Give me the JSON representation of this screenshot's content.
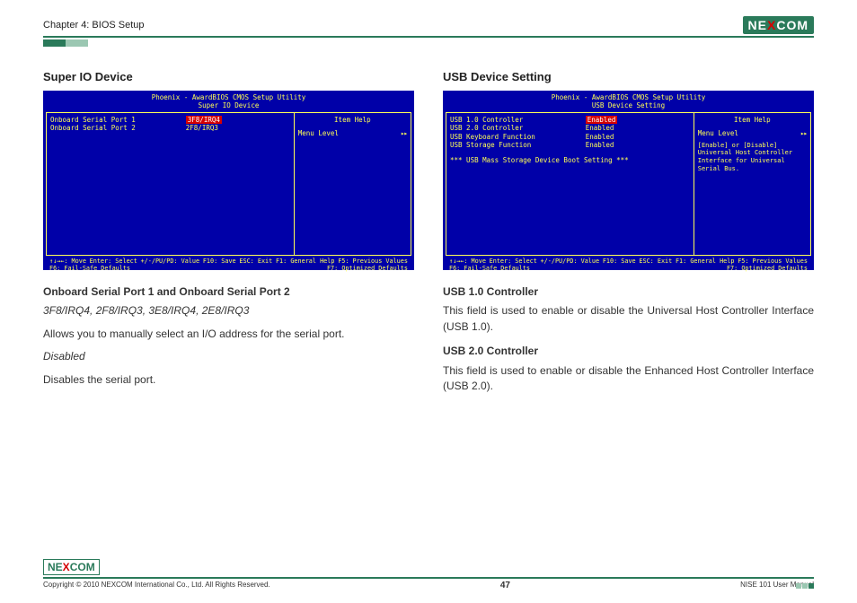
{
  "header": {
    "chapter": "Chapter 4: BIOS Setup",
    "logo_pre": "NE",
    "logo_x": "X",
    "logo_post": "COM"
  },
  "left": {
    "heading": "Super IO Device",
    "bios": {
      "title1": "Phoenix - AwardBIOS CMOS Setup Utility",
      "title2": "Super IO Device",
      "rows": [
        {
          "label": "Onboard Serial Port 1",
          "val": "3F8/IRQ4",
          "selected": true
        },
        {
          "label": "Onboard Serial Port 2",
          "val": "2F8/IRQ3",
          "selected": false
        }
      ],
      "item_help": "Item Help",
      "menu_level": "Menu Level",
      "menu_arrow": "▸▸",
      "help_text": "",
      "footer_keys": [
        "↑↓→←: Move",
        "Enter: Select",
        "+/-/PU/PD: Value",
        "F10: Save",
        "ESC: Exit",
        "F1: General Help",
        "F5: Previous Values",
        "F6: Fail-Safe Defaults",
        "F7: Optimized Defaults"
      ]
    },
    "body": {
      "sub": "Onboard Serial Port 1 and Onboard Serial Port 2",
      "italic1": "3F8/IRQ4, 2F8/IRQ3, 3E8/IRQ4, 2E8/IRQ3",
      "line1": "Allows you to manually select an I/O address for the serial port.",
      "italic2": "Disabled",
      "line2": "Disables the serial port."
    }
  },
  "right": {
    "heading": "USB Device Setting",
    "bios": {
      "title1": "Phoenix - AwardBIOS CMOS Setup Utility",
      "title2": "USB Device Setting",
      "rows": [
        {
          "label": "USB 1.0 Controller",
          "val": "Enabled",
          "selected": true
        },
        {
          "label": "USB 2.0 Controller",
          "val": "Enabled",
          "selected": false
        },
        {
          "label": "USB Keyboard Function",
          "val": "Enabled",
          "selected": false
        },
        {
          "label": "USB Storage Function",
          "val": "Enabled",
          "selected": false
        }
      ],
      "note": "*** USB Mass Storage Device Boot Setting ***",
      "item_help": "Item Help",
      "menu_level": "Menu Level",
      "menu_arrow": "▸▸",
      "help_text": "[Enable] or [Disable] Universal Host Controller Interface for Universal Serial Bus.",
      "footer_keys": [
        "↑↓→←: Move",
        "Enter: Select",
        "+/-/PU/PD: Value",
        "F10: Save",
        "ESC: Exit",
        "F1: General Help",
        "F5: Previous Values",
        "F6: Fail-Safe Defaults",
        "F7: Optimized Defaults"
      ]
    },
    "body": {
      "sub1": "USB 1.0 Controller",
      "p1": "This field is used to enable or disable the Universal Host Controller Interface (USB 1.0).",
      "sub2": "USB 2.0 Controller",
      "p2": "This field is used to enable or disable the Enhanced Host Controller Interface (USB 2.0)."
    }
  },
  "footer": {
    "logo_pre": "NE",
    "logo_x": "X",
    "logo_post": "COM",
    "copyright": "Copyright © 2010 NEXCOM International Co., Ltd. All Rights Reserved.",
    "page": "47",
    "manual": "NISE 101 User Manual"
  }
}
